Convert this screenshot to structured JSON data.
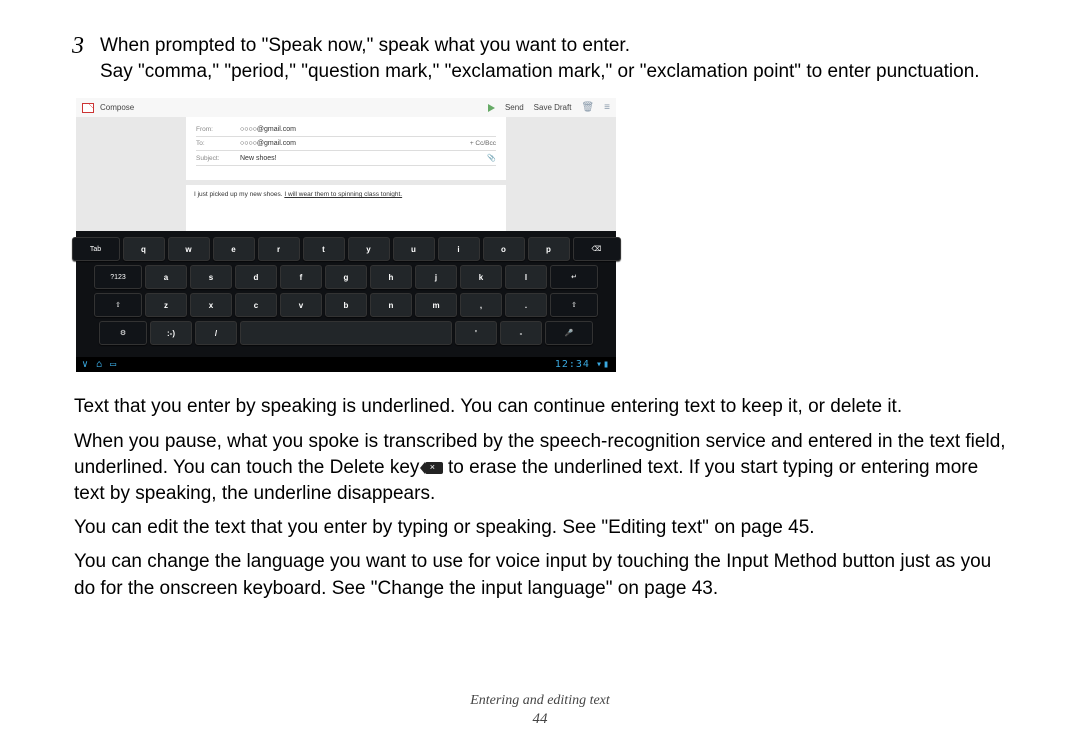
{
  "step": {
    "num": "3",
    "line1": "When prompted to \"Speak now,\" speak what you want to enter.",
    "line2": "Say \"comma,\" \"period,\" \"question mark,\" \"exclamation mark,\" or \"exclamation point\" to enter punctuation."
  },
  "email": {
    "compose": "Compose",
    "send": "Send",
    "savedraft": "Save Draft",
    "from_lbl": "From:",
    "from_val": "○○○○@gmail.com",
    "to_lbl": "To:",
    "to_val": "○○○○@gmail.com",
    "ccbcc": "+ Cc/Bcc",
    "subj_lbl": "Subject:",
    "subj_val": "New shoes!",
    "body_plain": "I just picked up my new shoes. ",
    "body_under": "I will wear them to spinning class tonight."
  },
  "keys": {
    "tab": "Tab",
    "n7123": "?123",
    "q": "q",
    "w": "w",
    "e": "e",
    "r": "r",
    "t": "t",
    "y": "y",
    "u": "u",
    "i": "i",
    "o": "o",
    "p": "p",
    "a": "a",
    "s": "s",
    "d": "d",
    "f": "f",
    "g": "g",
    "h": "h",
    "j": "j",
    "k": "k",
    "l": "l",
    "z": "z",
    "x": "x",
    "c": "c",
    "v": "v",
    "b": "b",
    "n": "n",
    "m": "m",
    "comma": ",",
    "dot": ".",
    "smile": ":-)",
    "slash": "/",
    "apos": "'",
    "dash": "-"
  },
  "sysbar": {
    "time": "12:34"
  },
  "paras": {
    "p1": "Text that you enter by speaking is underlined. You can continue entering text to keep it, or delete it.",
    "p2a": "When you pause, what you spoke is transcribed by the speech-recognition service and entered in the text field, underlined. You can touch the Delete key ",
    "p2b": " to erase the underlined text. If you start typing or entering more text by speaking, the underline disappears.",
    "p3": "You can edit the text that you enter by typing or speaking. See \"Editing text\" on page 45.",
    "p4": "You can change the language you want to use for voice input by touching the Input Method button just as you do for the onscreen keyboard. See \"Change the input language\" on page 43."
  },
  "footer": {
    "section": "Entering and editing text",
    "page": "44"
  }
}
